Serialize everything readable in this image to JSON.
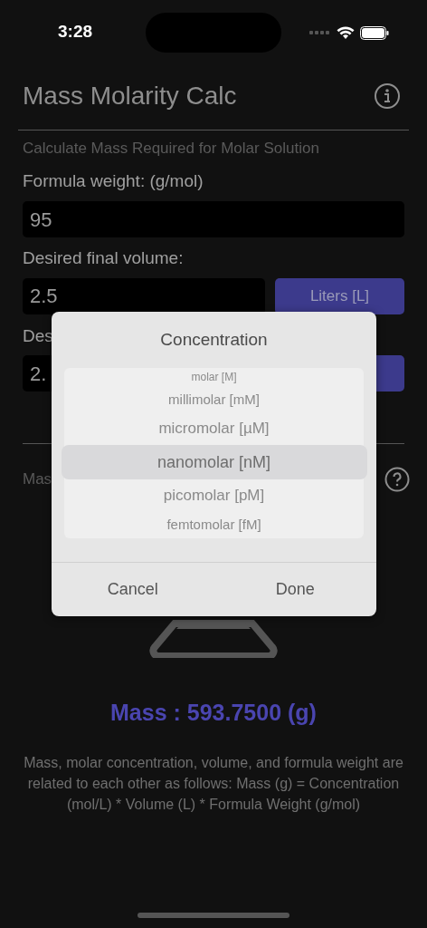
{
  "status_bar": {
    "time": "3:28"
  },
  "header": {
    "title": "Mass Molarity Calc"
  },
  "subtitle": "Calculate Mass Required for Molar Solution",
  "formula_weight": {
    "label": "Formula weight:  (g/mol)",
    "value": "95"
  },
  "volume": {
    "label": "Desired final volume:",
    "value": "2.5",
    "unit_button": "Liters [L]"
  },
  "concentration": {
    "label": "Des",
    "value": "2."
  },
  "mass_section": {
    "label": "Mas"
  },
  "result": "Mass : 593.7500 (g)",
  "explanation": "Mass, molar concentration, volume, and formula weight are related to each other as follows: Mass (g) = Concentration (mol/L) * Volume (L) * Formula Weight (g/mol)",
  "picker_dialog": {
    "title": "Concentration",
    "options": [
      {
        "label": "molar [M]",
        "selected": false
      },
      {
        "label": "millimolar [mM]",
        "selected": false
      },
      {
        "label": "micromolar [µM]",
        "selected": false
      },
      {
        "label": "nanomolar [nM]",
        "selected": true
      },
      {
        "label": "picomolar [pM]",
        "selected": false
      },
      {
        "label": "femtomolar [fM]",
        "selected": false
      }
    ],
    "buttons": [
      "Cancel",
      "Done"
    ]
  }
}
